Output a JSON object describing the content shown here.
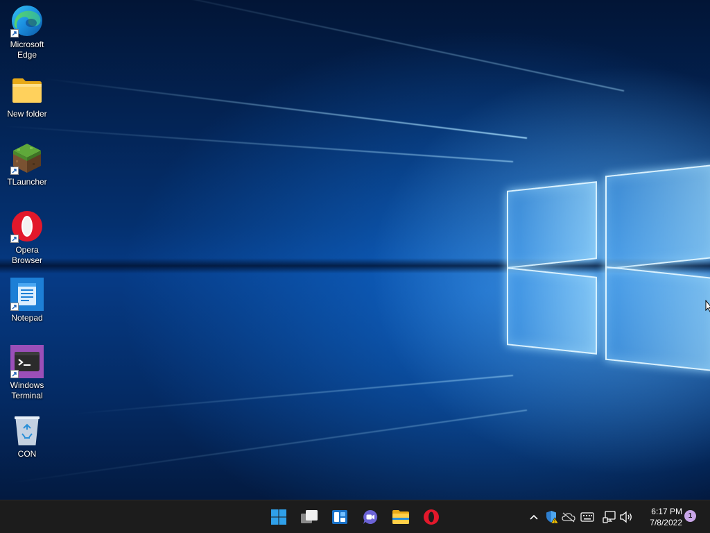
{
  "desktop": {
    "icons": [
      {
        "label": "Microsoft Edge",
        "icon": "edge-icon",
        "shortcut": true
      },
      {
        "label": "New folder",
        "icon": "folder-icon",
        "shortcut": false
      },
      {
        "label": "TLauncher",
        "icon": "grass-block-icon",
        "shortcut": true
      },
      {
        "label": "Opera Browser",
        "icon": "opera-icon",
        "shortcut": true
      },
      {
        "label": "Notepad",
        "icon": "notepad-icon",
        "shortcut": true
      },
      {
        "label": "Windows Terminal",
        "icon": "terminal-icon",
        "shortcut": true
      },
      {
        "label": "CON",
        "icon": "recycle-bin-icon",
        "shortcut": false
      }
    ]
  },
  "taskbar": {
    "apps": [
      {
        "name": "Start",
        "icon": "windows-start-icon"
      },
      {
        "name": "Task View",
        "icon": "task-view-icon"
      },
      {
        "name": "Widgets",
        "icon": "widgets-icon"
      },
      {
        "name": "Chat",
        "icon": "teams-chat-icon"
      },
      {
        "name": "File Explorer",
        "icon": "file-explorer-icon"
      },
      {
        "name": "Opera",
        "icon": "opera-icon"
      }
    ],
    "tray": [
      {
        "name": "Show hidden icons",
        "icon": "chevron-up-icon"
      },
      {
        "name": "Windows Security",
        "icon": "security-shield-icon"
      },
      {
        "name": "OneDrive",
        "icon": "onedrive-offline-icon"
      },
      {
        "name": "Touch keyboard",
        "icon": "keyboard-icon"
      },
      {
        "name": "Network",
        "icon": "network-icon"
      },
      {
        "name": "Volume",
        "icon": "speaker-icon"
      }
    ],
    "clock": {
      "time": "6:17 PM",
      "date": "7/8/2022"
    },
    "notification_count": "1"
  },
  "colors": {
    "taskbar_bg": "#1c1c1c",
    "accent": "#0078d4",
    "wallpaper_base": "#063b86"
  }
}
